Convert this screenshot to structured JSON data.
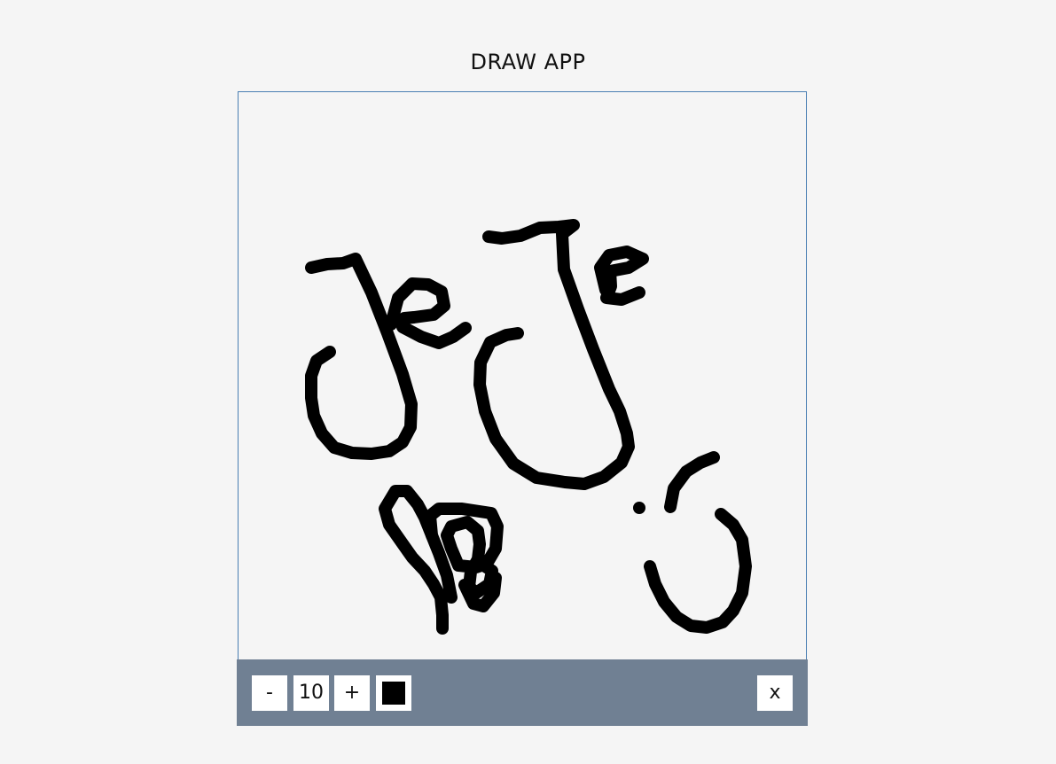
{
  "app": {
    "title": "DRAW APP"
  },
  "toolbox": {
    "decrease_label": "-",
    "brush_size": "10",
    "increase_label": "+",
    "color": "#000000",
    "clear_label": "x"
  },
  "canvas": {
    "background": "#f5f5f5",
    "stroke_color": "#000000"
  }
}
